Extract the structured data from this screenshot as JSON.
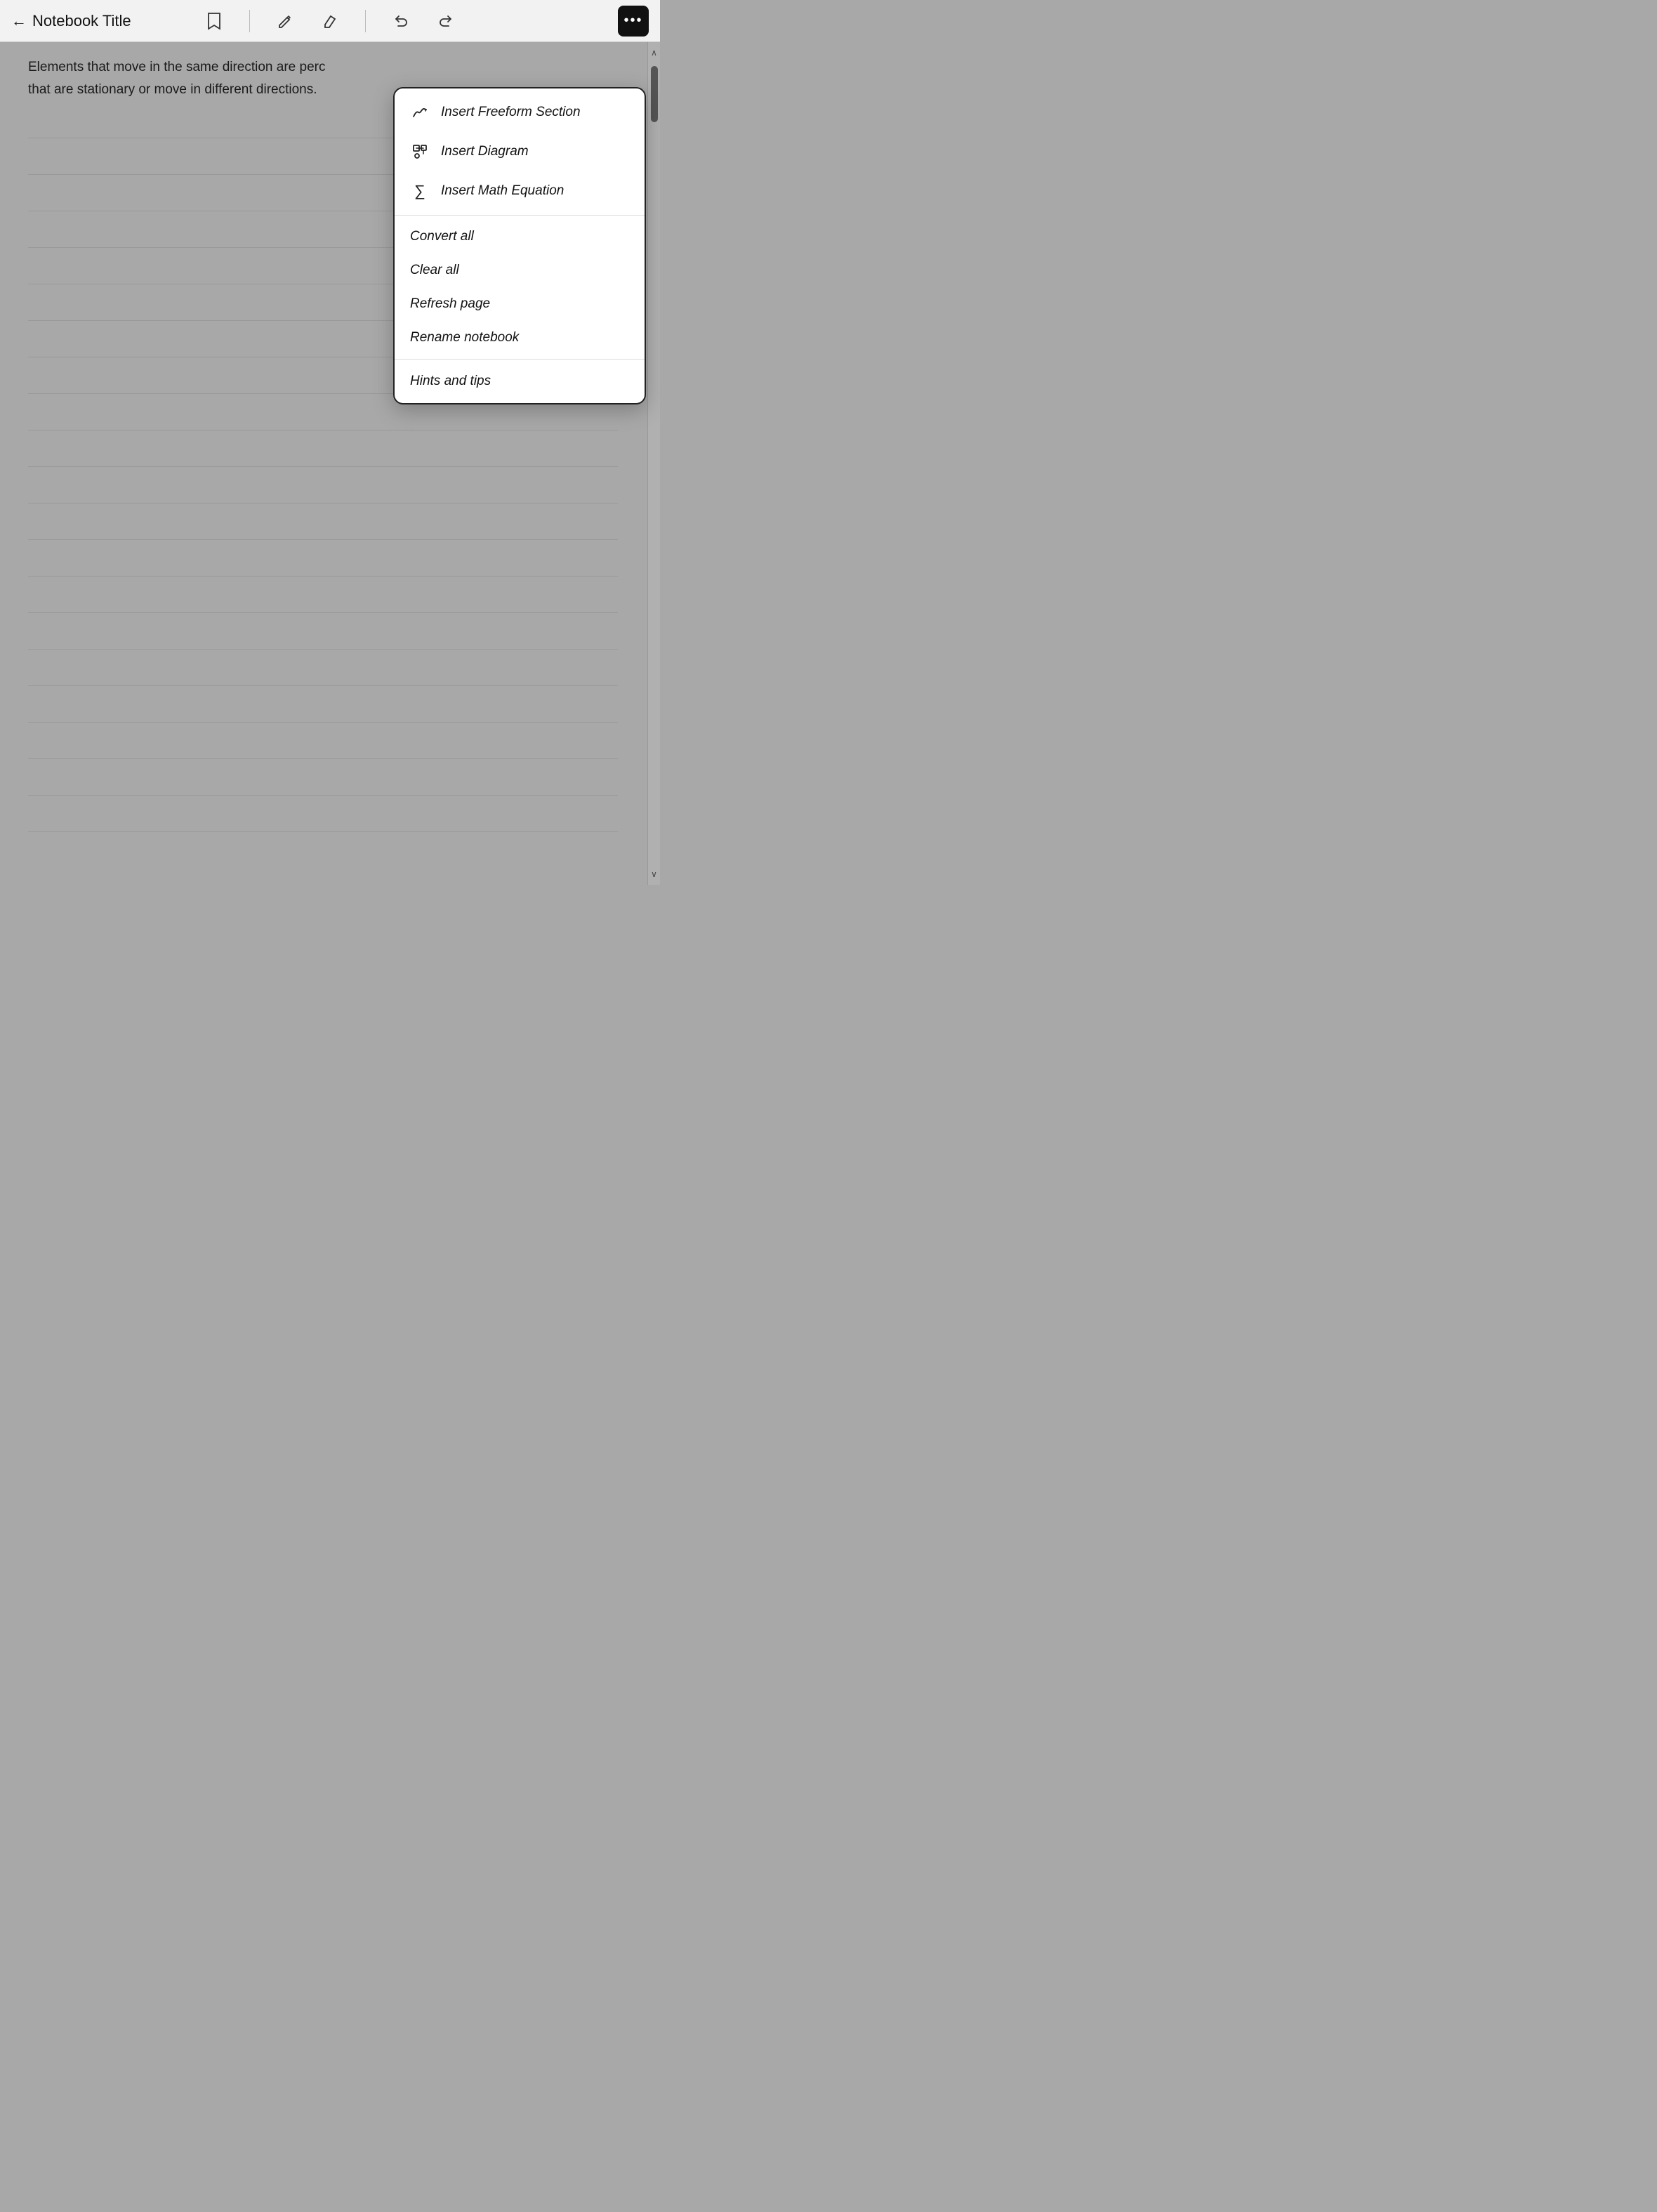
{
  "toolbar": {
    "back_label": "←",
    "title": "Notebook Title",
    "more_icon": "•••"
  },
  "content": {
    "text1": "Elements that move in the same direction are perc",
    "text2": "that are stationary or move in different directions."
  },
  "menu": {
    "items_top": [
      {
        "id": "insert-freeform",
        "icon": "✍",
        "label": "Insert Freeform Section"
      },
      {
        "id": "insert-diagram",
        "icon": "⬜",
        "label": "Insert Diagram"
      },
      {
        "id": "insert-math",
        "icon": "∑",
        "label": "Insert Math Equation"
      }
    ],
    "items_middle": [
      {
        "id": "convert-all",
        "label": "Convert all"
      },
      {
        "id": "clear-all",
        "label": "Clear all"
      },
      {
        "id": "refresh-page",
        "label": "Refresh page"
      },
      {
        "id": "rename-notebook",
        "label": "Rename notebook"
      }
    ],
    "items_bottom": [
      {
        "id": "hints-and-tips",
        "label": "Hints and tips"
      }
    ]
  },
  "scrollbar": {
    "up": "∧",
    "down": "∨"
  }
}
